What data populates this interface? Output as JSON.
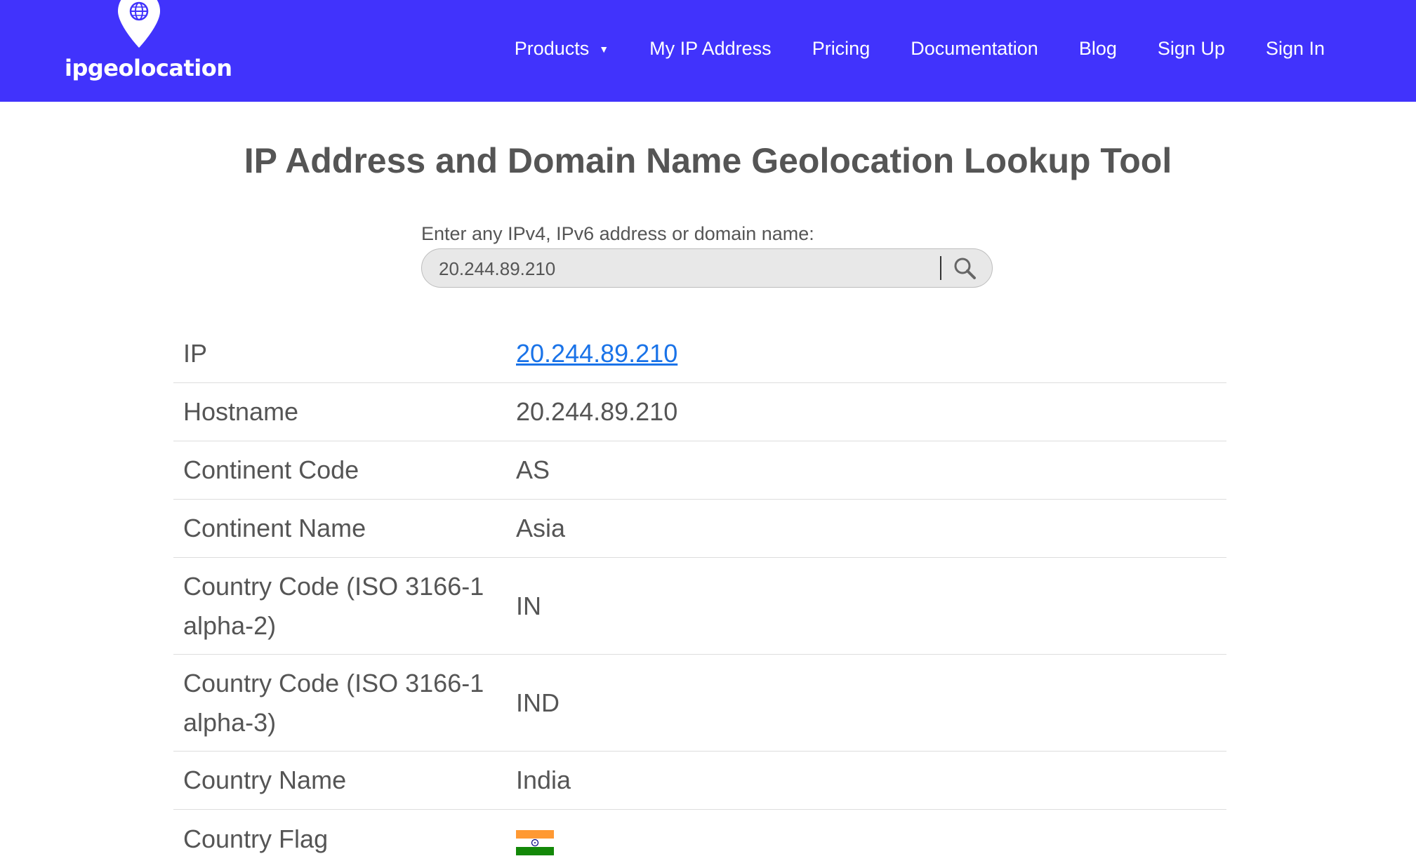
{
  "brand": {
    "name": "ipgeolocation"
  },
  "nav": {
    "items": [
      {
        "label": "Products",
        "has_dropdown": true
      },
      {
        "label": "My IP Address"
      },
      {
        "label": "Pricing"
      },
      {
        "label": "Documentation"
      },
      {
        "label": "Blog"
      },
      {
        "label": "Sign Up"
      },
      {
        "label": "Sign In"
      }
    ]
  },
  "page": {
    "title": "IP Address and Domain Name Geolocation Lookup Tool"
  },
  "search": {
    "label": "Enter any IPv4, IPv6 address or domain name:",
    "value": "20.244.89.210",
    "icon": "search-icon"
  },
  "results": {
    "rows": [
      {
        "label": "IP",
        "value": "20.244.89.210",
        "link": true
      },
      {
        "label": "Hostname",
        "value": "20.244.89.210"
      },
      {
        "label": "Continent Code",
        "value": "AS"
      },
      {
        "label": "Continent Name",
        "value": "Asia"
      },
      {
        "label": "Country Code (ISO 3166-1 alpha-2)",
        "value": "IN"
      },
      {
        "label": "Country Code (ISO 3166-1 alpha-3)",
        "value": "IND"
      },
      {
        "label": "Country Name",
        "value": "India"
      },
      {
        "label": "Country Flag",
        "flag": "india-flag"
      }
    ]
  },
  "colors": {
    "nav_bg": "#4133fc",
    "link": "#1a73e8",
    "text": "#555555"
  }
}
